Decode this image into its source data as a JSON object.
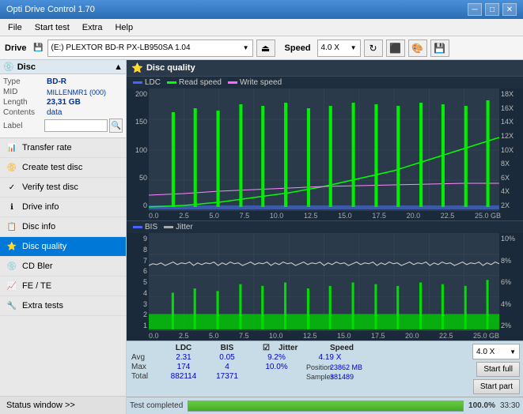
{
  "app": {
    "title": "Opti Drive Control 1.70",
    "title_icon": "💿"
  },
  "title_bar": {
    "minimize_label": "─",
    "maximize_label": "□",
    "close_label": "✕"
  },
  "menu": {
    "items": [
      "File",
      "Start test",
      "Extra",
      "Help"
    ]
  },
  "toolbar": {
    "drive_label": "Drive",
    "drive_icon": "💾",
    "drive_value": "(E:)  PLEXTOR BD-R  PX-LB950SA 1.04",
    "eject_icon": "⏏",
    "speed_label": "Speed",
    "speed_value": "4.0 X",
    "icon1": "↻",
    "icon2": "⬜",
    "icon3": "🎨",
    "icon4": "💾"
  },
  "disc": {
    "section_title": "Disc",
    "type_label": "Type",
    "type_value": "BD-R",
    "mid_label": "MID",
    "mid_value": "MILLENMR1 (000)",
    "length_label": "Length",
    "length_value": "23,31 GB",
    "contents_label": "Contents",
    "contents_value": "data",
    "label_label": "Label",
    "label_value": "",
    "label_btn": "🔍"
  },
  "nav_items": [
    {
      "id": "transfer-rate",
      "label": "Transfer rate",
      "icon": "📊"
    },
    {
      "id": "create-test-disc",
      "label": "Create test disc",
      "icon": "📀"
    },
    {
      "id": "verify-test-disc",
      "label": "Verify test disc",
      "icon": "✓"
    },
    {
      "id": "drive-info",
      "label": "Drive info",
      "icon": "ℹ"
    },
    {
      "id": "disc-info",
      "label": "Disc info",
      "icon": "📋"
    },
    {
      "id": "disc-quality",
      "label": "Disc quality",
      "icon": "⭐",
      "active": true
    },
    {
      "id": "cd-bler",
      "label": "CD Bler",
      "icon": "💿"
    },
    {
      "id": "fe-te",
      "label": "FE / TE",
      "icon": "📈"
    },
    {
      "id": "extra-tests",
      "label": "Extra tests",
      "icon": "🔧"
    }
  ],
  "status_window": {
    "label": "Status window >>"
  },
  "chart": {
    "title": "Disc quality",
    "icon": "⭐",
    "legend_upper": [
      {
        "label": "LDC",
        "color": "#4444ff"
      },
      {
        "label": "Read speed",
        "color": "#00ff00"
      },
      {
        "label": "Write speed",
        "color": "#ff66ff"
      }
    ],
    "legend_lower": [
      {
        "label": "BIS",
        "color": "#4444ff"
      },
      {
        "label": "Jitter",
        "color": "#aaaaaa"
      }
    ],
    "upper_y_left": [
      "200",
      "150",
      "100",
      "50",
      "0"
    ],
    "upper_y_right": [
      "18X",
      "16X",
      "14X",
      "12X",
      "10X",
      "8X",
      "6X",
      "4X",
      "2X"
    ],
    "lower_y_left": [
      "9",
      "8",
      "7",
      "6",
      "5",
      "4",
      "3",
      "2",
      "1"
    ],
    "lower_y_right": [
      "10%",
      "8%",
      "6%",
      "4%",
      "2%"
    ],
    "x_labels": [
      "0.0",
      "2.5",
      "5.0",
      "7.5",
      "10.0",
      "12.5",
      "15.0",
      "17.5",
      "20.0",
      "22.5",
      "25.0 GB"
    ]
  },
  "stats": {
    "headers": [
      "",
      "LDC",
      "BIS",
      "",
      "Jitter",
      "Speed",
      ""
    ],
    "avg_label": "Avg",
    "avg_ldc": "2.31",
    "avg_bis": "0.05",
    "avg_jitter": "9.2%",
    "avg_speed": "4.19 X",
    "max_label": "Max",
    "max_ldc": "174",
    "max_bis": "4",
    "max_jitter": "10.0%",
    "max_position": "23862 MB",
    "total_label": "Total",
    "total_ldc": "882114",
    "total_bis": "17371",
    "total_samples": "381489",
    "jitter_checked": true,
    "jitter_label": "Jitter",
    "speed_label": "Speed",
    "position_label": "Position",
    "samples_label": "Samples",
    "speed_dropdown": "4.0 X",
    "btn_start_full": "Start full",
    "btn_start_part": "Start part"
  },
  "bottom_bar": {
    "status_text": "Test completed",
    "progress_pct": "100.0%",
    "time_text": "33:30"
  }
}
